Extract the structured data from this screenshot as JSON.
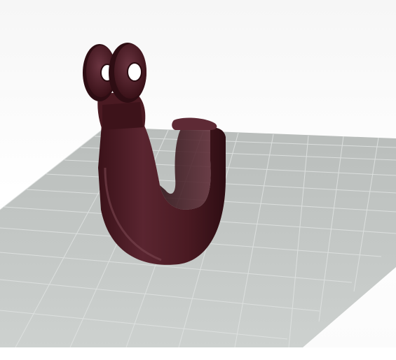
{
  "app": {
    "view": "3d-part-viewport",
    "part_color": "#4a1a22",
    "floor_color": "#c3c7c5"
  },
  "toolbar": {
    "groups": [
      [
        {
          "icon": "rotate-icon",
          "glyph": "↻"
        },
        {
          "icon": "pan-icon",
          "glyph": "✥"
        },
        {
          "icon": "zoom-icon",
          "glyph": "⊕"
        },
        {
          "icon": "fit-icon",
          "glyph": "▭"
        },
        {
          "icon": "normal-view-icon",
          "glyph": "◫"
        }
      ],
      [
        {
          "icon": "iso-view-icon",
          "glyph": "◈"
        },
        {
          "icon": "front-view-icon",
          "glyph": "▣"
        },
        {
          "icon": "top-view-icon",
          "glyph": "▤"
        },
        {
          "icon": "side-view-icon",
          "glyph": "▥"
        }
      ],
      [
        {
          "icon": "render-mode-icon",
          "glyph": "◐"
        }
      ],
      [
        {
          "icon": "hide-show-icon",
          "glyph": "◧"
        }
      ],
      [
        {
          "icon": "measure-icon",
          "glyph": "⟷"
        },
        {
          "icon": "section-icon",
          "glyph": "◒"
        },
        {
          "icon": "analysis-icon",
          "glyph": "◔"
        },
        {
          "icon": "layer-icon",
          "glyph": "▦"
        },
        {
          "icon": "camera-icon",
          "glyph": "◉"
        }
      ]
    ]
  }
}
